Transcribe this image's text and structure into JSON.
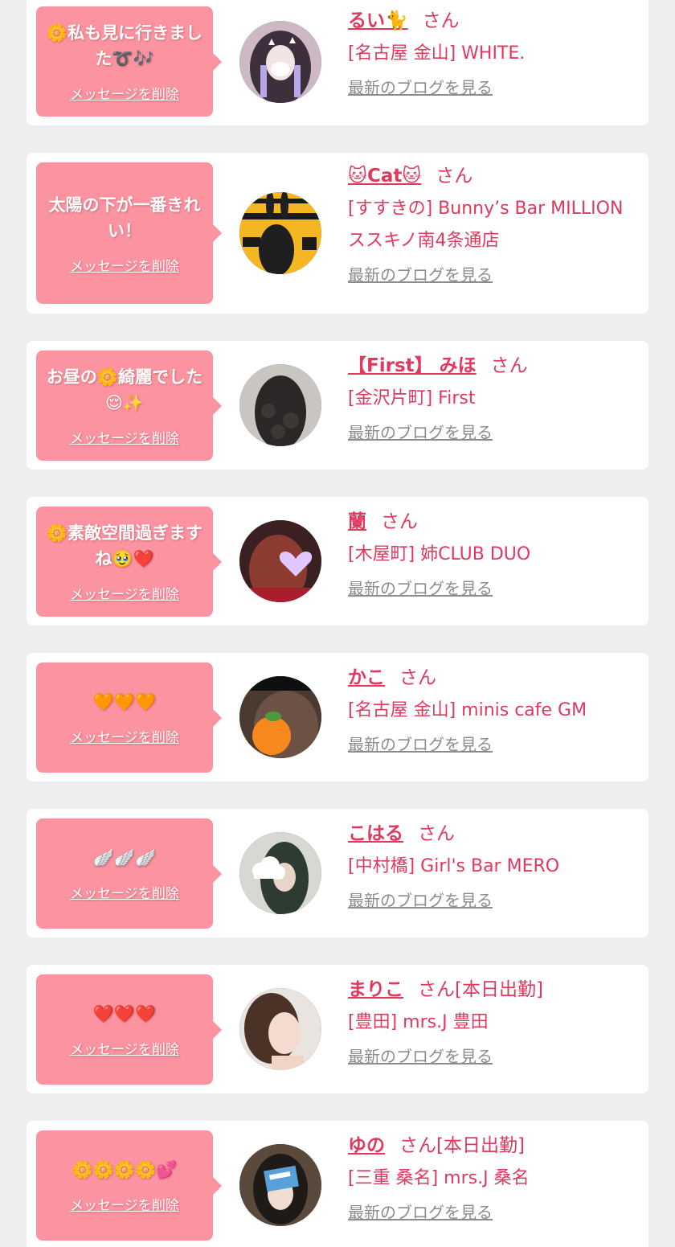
{
  "delete_label": "メッセージを削除",
  "blog_label": "最新のブログを見る",
  "san_label": "さん",
  "colors": {
    "background": "#eeeeef",
    "card": "#ffffff",
    "bubble": "#fc93a0",
    "accent_text": "#e0395e",
    "link_gray": "#8c8c8c"
  },
  "items": [
    {
      "message": "🌼私も見に行きました➰🎶",
      "name": "るい🐈",
      "san_suffix": "さん",
      "shop": "[名古屋 金山] WHITE.",
      "avatar": "avatar-girl-pastel"
    },
    {
      "message": "太陽の下が一番きれい！",
      "name": "🐱Cat🐱",
      "san_suffix": "さん",
      "shop": "[すすきの] Bunny’s Bar MILLION ススキノ南4条通店",
      "avatar": "avatar-bunny-poster"
    },
    {
      "message": "お昼の🌼綺麗でした😌✨",
      "name": "【First】 みほ",
      "san_suffix": "さん",
      "shop": "[金沢片町] First",
      "avatar": "avatar-curly-hair"
    },
    {
      "message": "🌼素敵空間過ぎますね🥹❤️",
      "name": "蘭",
      "san_suffix": "さん",
      "shop": "[木屋町] 姉CLUB DUO",
      "avatar": "avatar-heart-sticker"
    },
    {
      "message": "🧡🧡🧡",
      "name": "かこ",
      "san_suffix": "さん",
      "shop": "[名古屋 金山] minis cafe GM",
      "avatar": "avatar-orange-sticker"
    },
    {
      "message": "🪽🪽🪽",
      "name": "こはる",
      "san_suffix": "さん",
      "shop": "[中村橋] Girl's Bar MERO",
      "avatar": "avatar-cloud-sticker"
    },
    {
      "message": "❤️❤️❤️",
      "name": "まりこ",
      "san_suffix": "さん[本日出勤]",
      "shop": "[豊田] mrs.J 豊田",
      "avatar": "avatar-selfie"
    },
    {
      "message": "🌼🌼🌼🌼💕",
      "name": "ゆの",
      "san_suffix": "さん[本日出勤]",
      "shop": "[三重 桑名] mrs.J 桑名",
      "avatar": "avatar-card-cover"
    }
  ]
}
